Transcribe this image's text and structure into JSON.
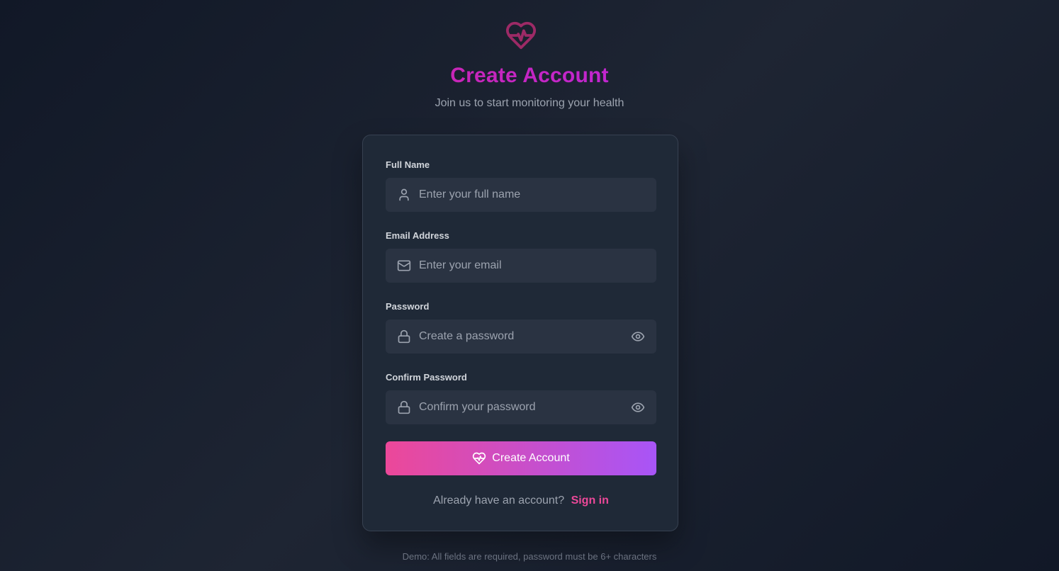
{
  "header": {
    "logo_icon": "heart-pulse-icon",
    "title": "Create Account",
    "subtitle": "Join us to start monitoring your health"
  },
  "form": {
    "full_name": {
      "label": "Full Name",
      "placeholder": "Enter your full name",
      "value": "",
      "icon": "user-icon"
    },
    "email": {
      "label": "Email Address",
      "placeholder": "Enter your email",
      "value": "",
      "icon": "mail-icon"
    },
    "password": {
      "label": "Password",
      "placeholder": "Create a password",
      "value": "",
      "icon": "lock-icon",
      "toggle_icon": "eye-icon"
    },
    "confirm_password": {
      "label": "Confirm Password",
      "placeholder": "Confirm your password",
      "value": "",
      "icon": "lock-icon",
      "toggle_icon": "eye-icon"
    },
    "submit_label": "Create Account",
    "submit_icon": "heart-pulse-icon",
    "signin_prompt": "Already have an account?",
    "signin_link": "Sign in"
  },
  "footer": {
    "note": "Demo: All fields are required, password must be 6+ characters"
  },
  "colors": {
    "background": "#111827",
    "card": "#1f2937",
    "input": "#2a3342",
    "accent_pink": "#ec4899",
    "accent_purple": "#a855f7",
    "logo": "#9d2a66"
  }
}
